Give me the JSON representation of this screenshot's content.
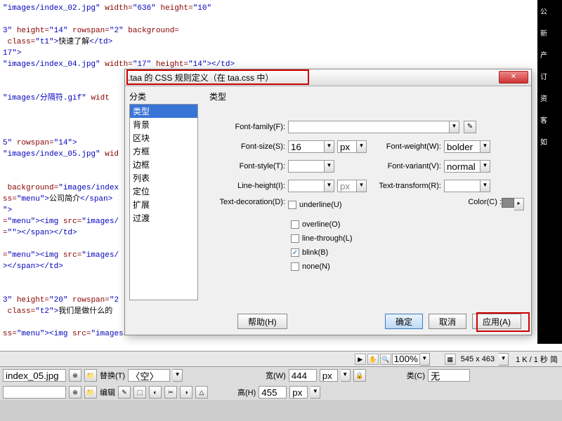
{
  "code_lines": [
    {
      "parts": [
        {
          "c": "val",
          "t": "\"images/index_02.jpg\""
        },
        {
          "c": "txt",
          "t": " "
        },
        {
          "c": "attr",
          "t": "width="
        },
        {
          "c": "val",
          "t": "\"636\""
        },
        {
          "c": "txt",
          "t": " "
        },
        {
          "c": "attr",
          "t": "height="
        },
        {
          "c": "val",
          "t": "\"10\""
        }
      ]
    },
    {
      "parts": []
    },
    {
      "parts": [
        {
          "c": "val",
          "t": "3\""
        },
        {
          "c": "txt",
          "t": " "
        },
        {
          "c": "attr",
          "t": "height="
        },
        {
          "c": "val",
          "t": "\"14\""
        },
        {
          "c": "txt",
          "t": " "
        },
        {
          "c": "attr",
          "t": "rowspan="
        },
        {
          "c": "val",
          "t": "\"2\""
        },
        {
          "c": "txt",
          "t": " "
        },
        {
          "c": "attr",
          "t": "background="
        }
      ]
    },
    {
      "parts": [
        {
          "c": "txt",
          "t": " "
        },
        {
          "c": "attr",
          "t": "class="
        },
        {
          "c": "val",
          "t": "\"t1\""
        },
        {
          "c": "tag",
          "t": ">"
        },
        {
          "c": "txt",
          "t": "快速了解"
        },
        {
          "c": "tag",
          "t": "</td>"
        }
      ]
    },
    {
      "parts": [
        {
          "c": "val",
          "t": "17\""
        },
        {
          "c": "tag",
          "t": ">"
        }
      ]
    },
    {
      "parts": [
        {
          "c": "val",
          "t": "\"images/index_04.jpg\""
        },
        {
          "c": "txt",
          "t": " "
        },
        {
          "c": "attr",
          "t": "width="
        },
        {
          "c": "val",
          "t": "\"17\""
        },
        {
          "c": "txt",
          "t": " "
        },
        {
          "c": "attr",
          "t": "height="
        },
        {
          "c": "val",
          "t": "\"14\""
        },
        {
          "c": "tag",
          "t": "></td>"
        }
      ]
    },
    {
      "parts": []
    },
    {
      "parts": []
    },
    {
      "parts": [
        {
          "c": "val",
          "t": "\"images/分隔符.gif\""
        },
        {
          "c": "txt",
          "t": " "
        },
        {
          "c": "attr",
          "t": "widt"
        }
      ]
    },
    {
      "parts": []
    },
    {
      "parts": []
    },
    {
      "parts": []
    },
    {
      "parts": [
        {
          "c": "val",
          "t": "5\""
        },
        {
          "c": "txt",
          "t": " "
        },
        {
          "c": "attr",
          "t": "rowspan="
        },
        {
          "c": "val",
          "t": "\"14\""
        },
        {
          "c": "tag",
          "t": ">"
        }
      ]
    },
    {
      "parts": [
        {
          "c": "val",
          "t": "\"images/index_05.jpg\""
        },
        {
          "c": "txt",
          "t": " "
        },
        {
          "c": "attr",
          "t": "wid"
        }
      ]
    },
    {
      "parts": []
    },
    {
      "parts": []
    },
    {
      "parts": [
        {
          "c": "txt",
          "t": " "
        },
        {
          "c": "attr",
          "t": "background="
        },
        {
          "c": "val",
          "t": "\"images/index"
        }
      ]
    },
    {
      "parts": [
        {
          "c": "attr",
          "t": "ss="
        },
        {
          "c": "val",
          "t": "\"menu\""
        },
        {
          "c": "tag",
          "t": ">"
        },
        {
          "c": "txt",
          "t": "公司简介"
        },
        {
          "c": "tag",
          "t": "</span>"
        }
      ]
    },
    {
      "parts": [
        {
          "c": "val",
          "t": "\""
        },
        {
          "c": "tag",
          "t": ">"
        }
      ]
    },
    {
      "parts": [
        {
          "c": "attr",
          "t": "="
        },
        {
          "c": "val",
          "t": "\"menu\""
        },
        {
          "c": "tag",
          "t": "><img "
        },
        {
          "c": "attr",
          "t": "src="
        },
        {
          "c": "val",
          "t": "\"images/"
        }
      ]
    },
    {
      "parts": [
        {
          "c": "attr",
          "t": "="
        },
        {
          "c": "val",
          "t": "\"\""
        },
        {
          "c": "tag",
          "t": "></span></td>"
        }
      ]
    },
    {
      "parts": []
    },
    {
      "parts": [
        {
          "c": "attr",
          "t": "="
        },
        {
          "c": "val",
          "t": "\"menu\""
        },
        {
          "c": "tag",
          "t": "><img "
        },
        {
          "c": "attr",
          "t": "src="
        },
        {
          "c": "val",
          "t": "\"images/"
        }
      ]
    },
    {
      "parts": [
        {
          "c": "tag",
          "t": "></span></td>"
        }
      ]
    },
    {
      "parts": []
    },
    {
      "parts": []
    },
    {
      "parts": [
        {
          "c": "val",
          "t": "3\""
        },
        {
          "c": "txt",
          "t": " "
        },
        {
          "c": "attr",
          "t": "height="
        },
        {
          "c": "val",
          "t": "\"20\""
        },
        {
          "c": "txt",
          "t": " "
        },
        {
          "c": "attr",
          "t": "rowspan="
        },
        {
          "c": "val",
          "t": "\"2"
        }
      ]
    },
    {
      "parts": [
        {
          "c": "txt",
          "t": " "
        },
        {
          "c": "attr",
          "t": "class="
        },
        {
          "c": "val",
          "t": "\"t2\""
        },
        {
          "c": "tag",
          "t": ">"
        },
        {
          "c": "txt",
          "t": "我们是做什么的"
        }
      ]
    },
    {
      "parts": []
    },
    {
      "parts": [
        {
          "c": "attr",
          "t": "ss="
        },
        {
          "c": "val",
          "t": "\"menu\""
        },
        {
          "c": "tag",
          "t": "><img "
        },
        {
          "c": "attr",
          "t": "src="
        },
        {
          "c": "val",
          "t": "\"images/"
        }
      ]
    }
  ],
  "dialog": {
    "title": ".taa 的 CSS 规则定义（在 taa.css 中）",
    "cat_label": "分类",
    "type_label": "类型",
    "categories": [
      "类型",
      "背景",
      "区块",
      "方框",
      "边框",
      "列表",
      "定位",
      "扩展",
      "过渡"
    ],
    "fields": {
      "font_family": "Font-family(F):",
      "font_size": "Font-size(S):",
      "font_style": "Font-style(T):",
      "line_height": "Line-height(I):",
      "text_decoration": "Text-decoration(D):",
      "font_weight": "Font-weight(W):",
      "font_variant": "Font-variant(V):",
      "text_transform": "Text-transform(R):",
      "color": "Color(C) :"
    },
    "values": {
      "font_size": "16",
      "font_size_unit": "px",
      "line_height_unit": "px",
      "font_weight": "bolder",
      "font_variant": "normal"
    },
    "decorations": {
      "underline": "underline(U)",
      "overline": "overline(O)",
      "linethrough": "line-through(L)",
      "blink": "blink(B)",
      "none": "none(N)"
    },
    "blink_checked": true,
    "buttons": {
      "help": "帮助(H)",
      "ok": "确定",
      "cancel": "取消",
      "apply": "应用(A)"
    }
  },
  "statusbar": {
    "zoom": "100%",
    "dims": "545 x 463",
    "timing": "1 K / 1 秒 简"
  },
  "bottom": {
    "file": "index_05.jpg",
    "replace_label": "替换(T)",
    "replace_val": "〈空〉",
    "edit_label": "编辑",
    "width_label": "宽(W)",
    "width_val": "444",
    "height_label": "高(H)",
    "height_val": "455",
    "unit": "px",
    "class_label": "类(C)",
    "class_val": "无"
  },
  "right_nav": [
    "公",
    "新",
    "产",
    "订",
    "资",
    "客",
    "如"
  ]
}
